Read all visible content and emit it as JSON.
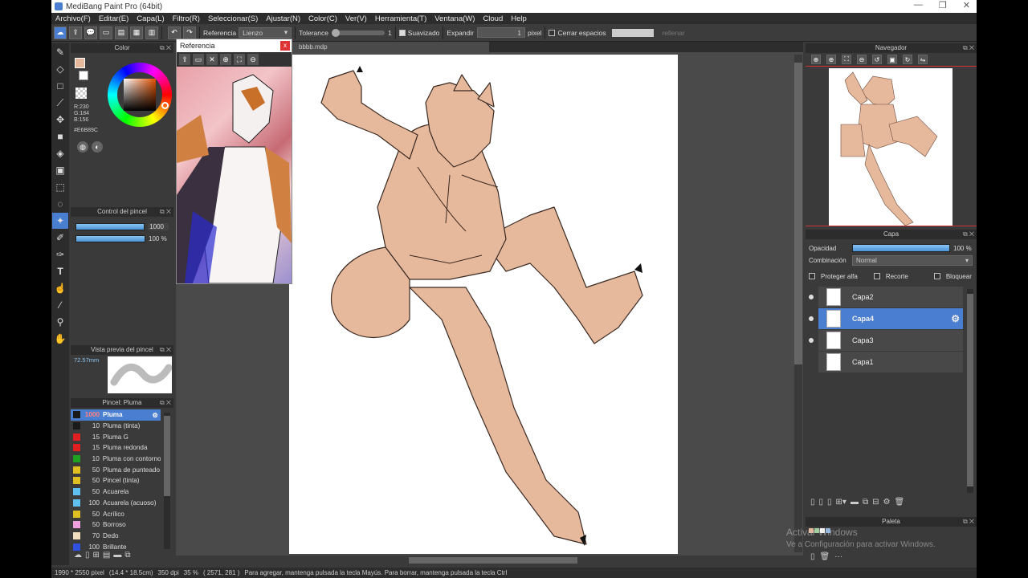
{
  "window": {
    "title": "MediBang Paint Pro (64bit)",
    "controls": [
      "—",
      "❐",
      "✕"
    ]
  },
  "menu": [
    "Archivo(F)",
    "Editar(E)",
    "Capa(L)",
    "Filtro(R)",
    "Seleccionar(S)",
    "Ajustar(N)",
    "Color(C)",
    "Ver(V)",
    "Herramienta(T)",
    "Ventana(W)",
    "Cloud",
    "Help"
  ],
  "toolbar": {
    "referencia_label": "Referencia",
    "referencia_value": "Lienzo",
    "tolerance_label": "Tolerance",
    "tolerance_value": "1",
    "suavizado_label": "Suavizado",
    "expandir_label": "Expandir",
    "expandir_value": "1",
    "pixel_label": "pixel",
    "cerrar_label": "Cerrar espacios",
    "rellenar_label": "rellenar"
  },
  "color_panel": {
    "title": "Color",
    "r": "R:230",
    "g": "G:184",
    "b": "B:156",
    "hex": "#E6B89C",
    "fg_color": "#e6b89c"
  },
  "brush_control": {
    "title": "Control del pincel",
    "size": "1000",
    "opacity": "100 %",
    "size_fill": 1.0,
    "opacity_fill": 1.0
  },
  "brush_preview": {
    "title": "Vista previa del pincel",
    "size": "72.57mm"
  },
  "brush_list": {
    "title": "Pincel: Pluma",
    "items": [
      {
        "size": "1000",
        "name": "Pluma",
        "color": "#1a1a1a",
        "selected": true
      },
      {
        "size": "10",
        "name": "Pluma (tinta)",
        "color": "#1a1a1a"
      },
      {
        "size": "15",
        "name": "Pluma G",
        "color": "#e02020"
      },
      {
        "size": "15",
        "name": "Pluma redonda",
        "color": "#e02020"
      },
      {
        "size": "10",
        "name": "Pluma con contorno",
        "color": "#20a020"
      },
      {
        "size": "50",
        "name": "Pluma de punteado",
        "color": "#e0c020"
      },
      {
        "size": "50",
        "name": "Pincel (tinta)",
        "color": "#e0c020"
      },
      {
        "size": "50",
        "name": "Acuarela",
        "color": "#60c0f0"
      },
      {
        "size": "100",
        "name": "Acuarela (acuoso)",
        "color": "#60c0f0"
      },
      {
        "size": "50",
        "name": "Acrílico",
        "color": "#e0c020"
      },
      {
        "size": "50",
        "name": "Borroso",
        "color": "#f0a0e0"
      },
      {
        "size": "70",
        "name": "Dedo",
        "color": "#f0e0c0"
      },
      {
        "size": "100",
        "name": "Brillante",
        "color": "#3050e0"
      }
    ]
  },
  "reference": {
    "title": "Referencia",
    "close": "x"
  },
  "canvas": {
    "tab": "bbbb.mdp"
  },
  "navigator": {
    "title": "Navegador"
  },
  "layers": {
    "title": "Capa",
    "opacity_label": "Opacidad",
    "opacity_value": "100 %",
    "blend_label": "Combinación",
    "blend_value": "Normal",
    "protect_alpha": "Proteger alfa",
    "clip": "Recorte",
    "lock": "Bloquear",
    "items": [
      {
        "name": "Capa2",
        "visible": true,
        "selected": false
      },
      {
        "name": "Capa4",
        "visible": true,
        "selected": true
      },
      {
        "name": "Capa3",
        "visible": true,
        "selected": false
      },
      {
        "name": "Capa1",
        "visible": false,
        "selected": false
      }
    ]
  },
  "palette": {
    "title": "Paleta"
  },
  "watermark": {
    "line1": "Activar Windows",
    "line2": "Ve a Configuración para activar Windows."
  },
  "status": {
    "size": "1990 * 2550 pixel",
    "cm": "(14.4 * 18.5cm)",
    "dpi": "350 dpi",
    "zoom": "35 %",
    "coords": "( 2571, 281 )",
    "hint": "Para agregar, mantenga pulsada la tecla Mayús. Para borrar, mantenga pulsada la tecla Ctrl"
  }
}
